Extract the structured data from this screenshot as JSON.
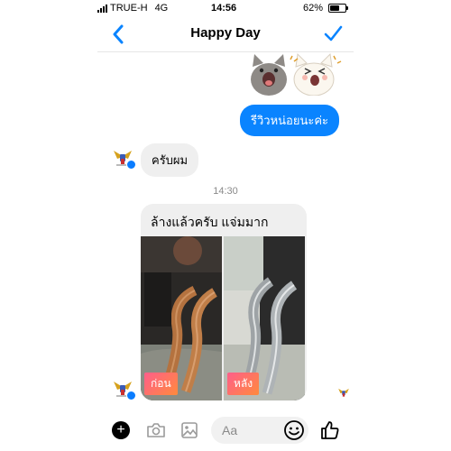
{
  "status_bar": {
    "carrier": "TRUE-H",
    "network": "4G",
    "time": "14:56",
    "battery": "62%",
    "battery_level": 0.62
  },
  "header": {
    "title": "Happy Day",
    "back_icon": "chevron-left-icon",
    "action_icon": "checkmark-icon"
  },
  "messages": {
    "outgoing_text": "รีวิวหน่อยนะค่ะ",
    "incoming_text": "ครับผม",
    "timestamp": "14:30",
    "card_text": "ล้างแล้วครับ  แจ่มมาก",
    "before_label": "ก่อน",
    "after_label": "หลัง"
  },
  "composer": {
    "placeholder": "Aa",
    "icons": [
      "plus-icon",
      "camera-icon",
      "photo-icon",
      "emoji-icon",
      "thumbs-up-icon"
    ]
  },
  "colors": {
    "accent": "#0a84ff",
    "bubble_in": "#efefef",
    "tag_gradient_start": "#ff5e8a",
    "tag_gradient_end": "#ff8a3d"
  }
}
